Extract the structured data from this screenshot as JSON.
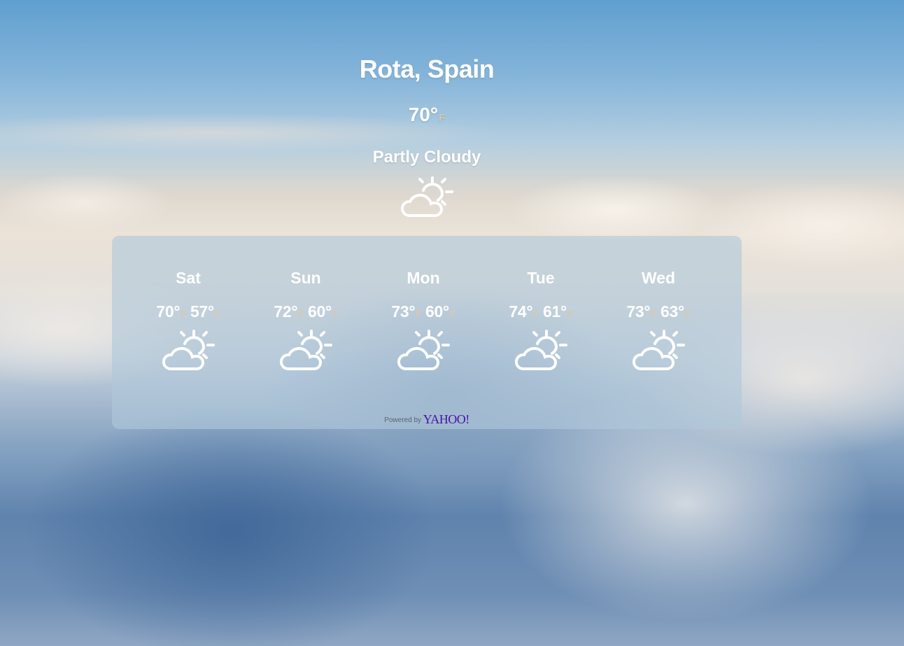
{
  "current": {
    "city": "Rota, Spain",
    "temp": "70°",
    "unit": "F",
    "condition": "Partly Cloudy",
    "icon": "partly-cloudy-icon"
  },
  "forecast": [
    {
      "day": "Sat",
      "high": "70°",
      "low": "57°",
      "unit": "F",
      "icon": "partly-cloudy-icon"
    },
    {
      "day": "Sun",
      "high": "72°",
      "low": "60°",
      "unit": "F",
      "icon": "partly-cloudy-icon"
    },
    {
      "day": "Mon",
      "high": "73°",
      "low": "60°",
      "unit": "F",
      "icon": "partly-cloudy-icon"
    },
    {
      "day": "Tue",
      "high": "74°",
      "low": "61°",
      "unit": "F",
      "icon": "partly-cloudy-icon"
    },
    {
      "day": "Wed",
      "high": "73°",
      "low": "63°",
      "unit": "F",
      "icon": "partly-cloudy-icon"
    }
  ],
  "attribution": {
    "prefix": "Powered by",
    "brand": "YAHOO!"
  },
  "colors": {
    "unit": "#d9c8ae",
    "panel": "rgba(176,200,218,0.62)",
    "brand": "#4b12a8"
  }
}
